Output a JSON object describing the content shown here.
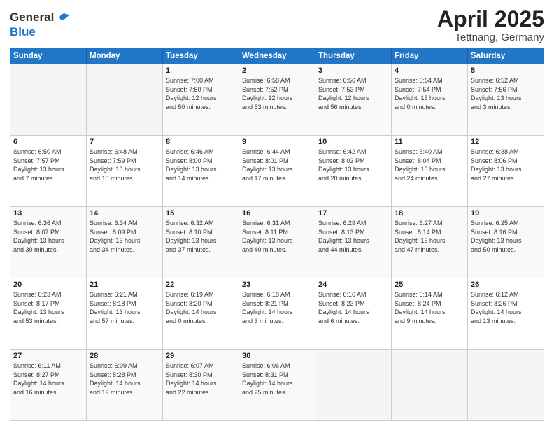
{
  "header": {
    "logo_line1": "General",
    "logo_line2": "Blue",
    "title": "April 2025",
    "subtitle": "Tettnang, Germany"
  },
  "weekdays": [
    "Sunday",
    "Monday",
    "Tuesday",
    "Wednesday",
    "Thursday",
    "Friday",
    "Saturday"
  ],
  "weeks": [
    [
      {
        "day": "",
        "info": ""
      },
      {
        "day": "",
        "info": ""
      },
      {
        "day": "1",
        "info": "Sunrise: 7:00 AM\nSunset: 7:50 PM\nDaylight: 12 hours\nand 50 minutes."
      },
      {
        "day": "2",
        "info": "Sunrise: 6:58 AM\nSunset: 7:52 PM\nDaylight: 12 hours\nand 53 minutes."
      },
      {
        "day": "3",
        "info": "Sunrise: 6:56 AM\nSunset: 7:53 PM\nDaylight: 12 hours\nand 56 minutes."
      },
      {
        "day": "4",
        "info": "Sunrise: 6:54 AM\nSunset: 7:54 PM\nDaylight: 13 hours\nand 0 minutes."
      },
      {
        "day": "5",
        "info": "Sunrise: 6:52 AM\nSunset: 7:56 PM\nDaylight: 13 hours\nand 3 minutes."
      }
    ],
    [
      {
        "day": "6",
        "info": "Sunrise: 6:50 AM\nSunset: 7:57 PM\nDaylight: 13 hours\nand 7 minutes."
      },
      {
        "day": "7",
        "info": "Sunrise: 6:48 AM\nSunset: 7:59 PM\nDaylight: 13 hours\nand 10 minutes."
      },
      {
        "day": "8",
        "info": "Sunrise: 6:46 AM\nSunset: 8:00 PM\nDaylight: 13 hours\nand 14 minutes."
      },
      {
        "day": "9",
        "info": "Sunrise: 6:44 AM\nSunset: 8:01 PM\nDaylight: 13 hours\nand 17 minutes."
      },
      {
        "day": "10",
        "info": "Sunrise: 6:42 AM\nSunset: 8:03 PM\nDaylight: 13 hours\nand 20 minutes."
      },
      {
        "day": "11",
        "info": "Sunrise: 6:40 AM\nSunset: 8:04 PM\nDaylight: 13 hours\nand 24 minutes."
      },
      {
        "day": "12",
        "info": "Sunrise: 6:38 AM\nSunset: 8:06 PM\nDaylight: 13 hours\nand 27 minutes."
      }
    ],
    [
      {
        "day": "13",
        "info": "Sunrise: 6:36 AM\nSunset: 8:07 PM\nDaylight: 13 hours\nand 30 minutes."
      },
      {
        "day": "14",
        "info": "Sunrise: 6:34 AM\nSunset: 8:09 PM\nDaylight: 13 hours\nand 34 minutes."
      },
      {
        "day": "15",
        "info": "Sunrise: 6:32 AM\nSunset: 8:10 PM\nDaylight: 13 hours\nand 37 minutes."
      },
      {
        "day": "16",
        "info": "Sunrise: 6:31 AM\nSunset: 8:11 PM\nDaylight: 13 hours\nand 40 minutes."
      },
      {
        "day": "17",
        "info": "Sunrise: 6:29 AM\nSunset: 8:13 PM\nDaylight: 13 hours\nand 44 minutes."
      },
      {
        "day": "18",
        "info": "Sunrise: 6:27 AM\nSunset: 8:14 PM\nDaylight: 13 hours\nand 47 minutes."
      },
      {
        "day": "19",
        "info": "Sunrise: 6:25 AM\nSunset: 8:16 PM\nDaylight: 13 hours\nand 50 minutes."
      }
    ],
    [
      {
        "day": "20",
        "info": "Sunrise: 6:23 AM\nSunset: 8:17 PM\nDaylight: 13 hours\nand 53 minutes."
      },
      {
        "day": "21",
        "info": "Sunrise: 6:21 AM\nSunset: 8:18 PM\nDaylight: 13 hours\nand 57 minutes."
      },
      {
        "day": "22",
        "info": "Sunrise: 6:19 AM\nSunset: 8:20 PM\nDaylight: 14 hours\nand 0 minutes."
      },
      {
        "day": "23",
        "info": "Sunrise: 6:18 AM\nSunset: 8:21 PM\nDaylight: 14 hours\nand 3 minutes."
      },
      {
        "day": "24",
        "info": "Sunrise: 6:16 AM\nSunset: 8:23 PM\nDaylight: 14 hours\nand 6 minutes."
      },
      {
        "day": "25",
        "info": "Sunrise: 6:14 AM\nSunset: 8:24 PM\nDaylight: 14 hours\nand 9 minutes."
      },
      {
        "day": "26",
        "info": "Sunrise: 6:12 AM\nSunset: 8:26 PM\nDaylight: 14 hours\nand 13 minutes."
      }
    ],
    [
      {
        "day": "27",
        "info": "Sunrise: 6:11 AM\nSunset: 8:27 PM\nDaylight: 14 hours\nand 16 minutes."
      },
      {
        "day": "28",
        "info": "Sunrise: 6:09 AM\nSunset: 8:28 PM\nDaylight: 14 hours\nand 19 minutes."
      },
      {
        "day": "29",
        "info": "Sunrise: 6:07 AM\nSunset: 8:30 PM\nDaylight: 14 hours\nand 22 minutes."
      },
      {
        "day": "30",
        "info": "Sunrise: 6:06 AM\nSunset: 8:31 PM\nDaylight: 14 hours\nand 25 minutes."
      },
      {
        "day": "",
        "info": ""
      },
      {
        "day": "",
        "info": ""
      },
      {
        "day": "",
        "info": ""
      }
    ]
  ]
}
